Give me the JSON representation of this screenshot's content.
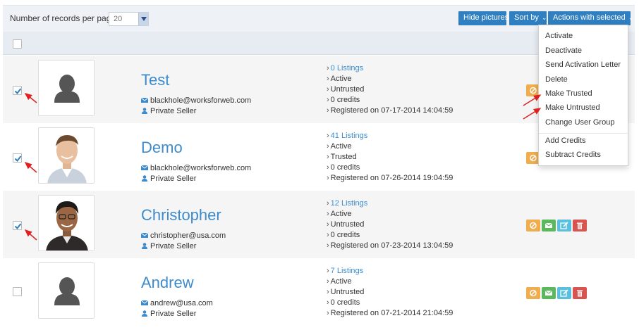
{
  "toolbar": {
    "records_label": "Number of records per page",
    "records_value": "20",
    "hide_pictures": "Hide pictures",
    "sort_by": "Sort by",
    "actions_with_selected": "Actions with selected"
  },
  "dropdown": {
    "items": [
      "Activate",
      "Deactivate",
      "Send Activation Letter",
      "Delete",
      "Make Trusted",
      "Make Untrusted",
      "Change User Group",
      "Add Credits",
      "Subtract Credits"
    ]
  },
  "users": [
    {
      "name": "Test",
      "email": "blackhole@worksforweb.com",
      "type": "Private Seller",
      "listings": "0 Listings",
      "status": "Active",
      "trust": "Untrusted",
      "credits": "0 credits",
      "registered": "Registered on 07-17-2014 14:04:59",
      "checked": true
    },
    {
      "name": "Demo",
      "email": "blackhole@worksforweb.com",
      "type": "Private Seller",
      "listings": "41 Listings",
      "status": "Active",
      "trust": "Trusted",
      "credits": "0 credits",
      "registered": "Registered on 07-26-2014 19:04:59",
      "checked": true
    },
    {
      "name": "Christopher",
      "email": "christopher@usa.com",
      "type": "Private Seller",
      "listings": "12 Listings",
      "status": "Active",
      "trust": "Untrusted",
      "credits": "0 credits",
      "registered": "Registered on 07-23-2014 13:04:59",
      "checked": true
    },
    {
      "name": "Andrew",
      "email": "andrew@usa.com",
      "type": "Private Seller",
      "listings": "7 Listings",
      "status": "Active",
      "trust": "Untrusted",
      "credits": "0 credits",
      "registered": "Registered on 07-21-2014 21:04:59",
      "checked": false
    }
  ],
  "colors": {
    "accent": "#2f7fc1",
    "link": "#3d8bcc",
    "deactivate": "#f0ad4e",
    "mail": "#5cb85c",
    "edit": "#5bc0de",
    "delete": "#d9534f",
    "annotation": "#e02020"
  },
  "icons": [
    "chevron-down-icon",
    "envelope-icon",
    "user-icon",
    "ban-icon",
    "edit-icon",
    "trash-icon",
    "checkmark-icon",
    "default-avatar-icon"
  ]
}
